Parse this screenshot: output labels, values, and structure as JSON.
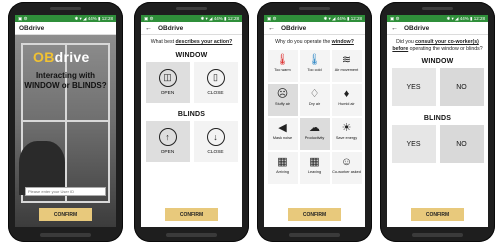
{
  "status": {
    "left": "▣ ⚙",
    "right": "✱ ▾ ◢ 44% ▮ 12:28"
  },
  "app": {
    "title": "OBdrive",
    "back": "←"
  },
  "screen1": {
    "logo_prefix": "OB",
    "logo_suffix": "drive",
    "intro": "Interacting with WINDOW or BLINDS?",
    "user_id_placeholder": "Please enter your User ID",
    "confirm": "CONFIRM"
  },
  "screen2": {
    "question_pre": "What best ",
    "question_em": "describes your action?",
    "window_title": "WINDOW",
    "window_options": [
      "OPEN",
      "CLOSE"
    ],
    "blinds_title": "BLINDS",
    "blinds_options": [
      "OPEN",
      "CLOSE"
    ],
    "confirm": "CONFIRM"
  },
  "screen3": {
    "question_pre": "Why do you operate the ",
    "question_em": "window?",
    "reasons": [
      {
        "label": "Too warm",
        "icon": "thermometer-hot-icon",
        "glyph": "🌡"
      },
      {
        "label": "Too cold",
        "icon": "thermometer-cold-icon",
        "glyph": "🌡"
      },
      {
        "label": "Air movement",
        "icon": "wind-icon",
        "glyph": "≋"
      },
      {
        "label": "Stuffy air",
        "icon": "stuffy-face-icon",
        "glyph": "☹"
      },
      {
        "label": "Dry air",
        "icon": "droplet-icon",
        "glyph": "♢"
      },
      {
        "label": "Humid air",
        "icon": "droplet-humid-icon",
        "glyph": "♦"
      },
      {
        "label": "Mask noise",
        "icon": "speaker-icon",
        "glyph": "◀"
      },
      {
        "label": "Productivity",
        "icon": "brain-icon",
        "glyph": "☁"
      },
      {
        "label": "Save energy",
        "icon": "lightbulb-icon",
        "glyph": "☀"
      },
      {
        "label": "Arriving",
        "icon": "arriving-icon",
        "glyph": "▦"
      },
      {
        "label": "Leaving",
        "icon": "leaving-icon",
        "glyph": "▦"
      },
      {
        "label": "Co-worker asked",
        "icon": "coworker-icon",
        "glyph": "☺"
      }
    ],
    "confirm": "CONFIRM"
  },
  "screen4": {
    "question_pre": "Did you ",
    "question_em1": "consult your co-worker(s)",
    "question_mid": " ",
    "question_em2": "before",
    "question_post": " operating the window or blinds?",
    "window_title": "WINDOW",
    "blinds_title": "BLINDS",
    "yes": "YES",
    "no": "NO",
    "confirm": "CONFIRM"
  }
}
